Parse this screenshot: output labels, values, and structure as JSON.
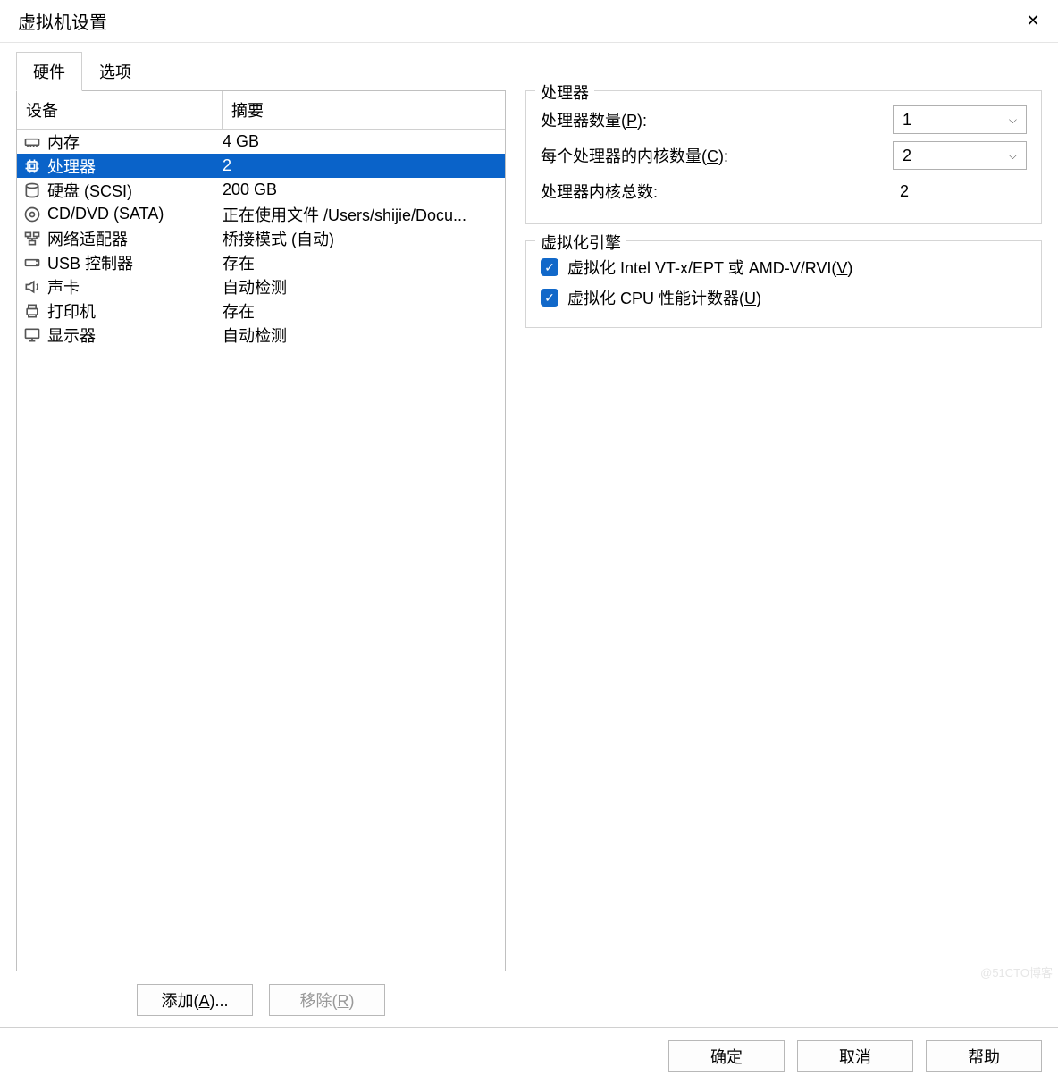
{
  "title": "虚拟机设置",
  "close": "✕",
  "tabs": {
    "hardware": "硬件",
    "options": "选项"
  },
  "listHeader": {
    "device": "设备",
    "summary": "摘要"
  },
  "devices": [
    {
      "icon": "memory-icon",
      "name": "内存",
      "summary": "4 GB"
    },
    {
      "icon": "cpu-icon",
      "name": "处理器",
      "summary": "2"
    },
    {
      "icon": "disk-icon",
      "name": "硬盘 (SCSI)",
      "summary": "200 GB"
    },
    {
      "icon": "cd-icon",
      "name": "CD/DVD (SATA)",
      "summary": "正在使用文件 /Users/shijie/Docu..."
    },
    {
      "icon": "network-icon",
      "name": "网络适配器",
      "summary": "桥接模式 (自动)"
    },
    {
      "icon": "usb-icon",
      "name": "USB 控制器",
      "summary": "存在"
    },
    {
      "icon": "sound-icon",
      "name": "声卡",
      "summary": "自动检测"
    },
    {
      "icon": "printer-icon",
      "name": "打印机",
      "summary": "存在"
    },
    {
      "icon": "display-icon",
      "name": "显示器",
      "summary": "自动检测"
    }
  ],
  "selectedIndex": 1,
  "leftButtons": {
    "add": "添加(A)...",
    "remove": "移除(R)"
  },
  "processors": {
    "legend": "处理器",
    "numProcessorsLabelPrefix": "处理器数量(",
    "numProcessorsLabelKey": "P",
    "numProcessorsLabelSuffix": "):",
    "numProcessorsValue": "1",
    "coresPerProcLabelPrefix": "每个处理器的内核数量(",
    "coresPerProcLabelKey": "C",
    "coresPerProcLabelSuffix": "):",
    "coresPerProcValue": "2",
    "totalCoresLabel": "处理器内核总数:",
    "totalCoresValue": "2"
  },
  "virtEngine": {
    "legend": "虚拟化引擎",
    "vtxLabelPrefix": "虚拟化 Intel VT-x/EPT 或 AMD-V/RVI(",
    "vtxLabelKey": "V",
    "vtxLabelSuffix": ")",
    "vtxChecked": true,
    "perfLabelPrefix": "虚拟化 CPU 性能计数器(",
    "perfLabelKey": "U",
    "perfLabelSuffix": ")",
    "perfChecked": true
  },
  "footer": {
    "ok": "确定",
    "cancel": "取消",
    "help": "帮助"
  },
  "watermark": "@51CTO博客"
}
